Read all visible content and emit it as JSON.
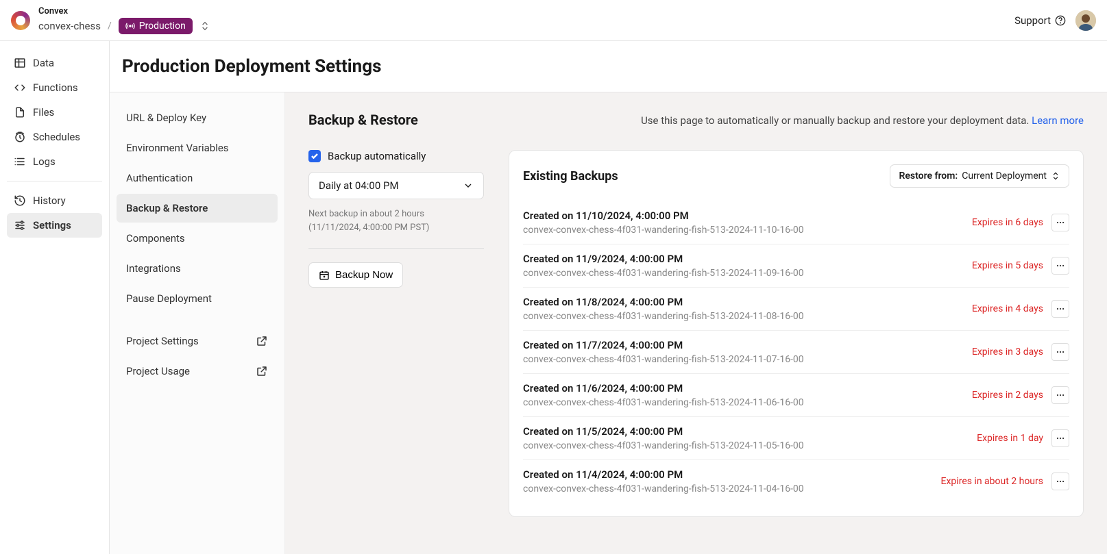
{
  "header": {
    "org": "Convex",
    "project": "convex-chess",
    "env": "Production",
    "support": "Support"
  },
  "leftnav": [
    {
      "icon": "table",
      "label": "Data"
    },
    {
      "icon": "code",
      "label": "Functions"
    },
    {
      "icon": "file",
      "label": "Files"
    },
    {
      "icon": "clock",
      "label": "Schedules"
    },
    {
      "icon": "list",
      "label": "Logs"
    },
    {
      "divider": true
    },
    {
      "icon": "history",
      "label": "History"
    },
    {
      "icon": "sliders",
      "label": "Settings",
      "active": true
    }
  ],
  "page_title": "Production Deployment Settings",
  "settings_nav": [
    {
      "label": "URL & Deploy Key"
    },
    {
      "label": "Environment Variables"
    },
    {
      "label": "Authentication"
    },
    {
      "label": "Backup & Restore",
      "active": true
    },
    {
      "label": "Components"
    },
    {
      "label": "Integrations"
    },
    {
      "label": "Pause Deployment"
    },
    {
      "gap": true
    },
    {
      "label": "Project Settings",
      "external": true
    },
    {
      "label": "Project Usage",
      "external": true
    }
  ],
  "backup": {
    "title": "Backup & Restore",
    "description": "Use this page to automatically or manually backup and restore your deployment data. ",
    "learn_more": "Learn more",
    "auto_label": "Backup automatically",
    "auto_checked": true,
    "schedule": "Daily at 04:00 PM",
    "next_backup_line1": "Next backup in about 2 hours",
    "next_backup_line2": "(11/11/2024, 4:00:00 PM PST)",
    "backup_now": "Backup Now",
    "existing_title": "Existing Backups",
    "restore_label": "Restore from:",
    "restore_value": "Current Deployment",
    "items": [
      {
        "title": "Created on 11/10/2024, 4:00:00 PM",
        "sub": "convex-convex-chess-4f031-wandering-fish-513-2024-11-10-16-00",
        "expires": "Expires in 6 days"
      },
      {
        "title": "Created on 11/9/2024, 4:00:00 PM",
        "sub": "convex-convex-chess-4f031-wandering-fish-513-2024-11-09-16-00",
        "expires": "Expires in 5 days"
      },
      {
        "title": "Created on 11/8/2024, 4:00:00 PM",
        "sub": "convex-convex-chess-4f031-wandering-fish-513-2024-11-08-16-00",
        "expires": "Expires in 4 days"
      },
      {
        "title": "Created on 11/7/2024, 4:00:00 PM",
        "sub": "convex-convex-chess-4f031-wandering-fish-513-2024-11-07-16-00",
        "expires": "Expires in 3 days"
      },
      {
        "title": "Created on 11/6/2024, 4:00:00 PM",
        "sub": "convex-convex-chess-4f031-wandering-fish-513-2024-11-06-16-00",
        "expires": "Expires in 2 days"
      },
      {
        "title": "Created on 11/5/2024, 4:00:00 PM",
        "sub": "convex-convex-chess-4f031-wandering-fish-513-2024-11-05-16-00",
        "expires": "Expires in 1 day"
      },
      {
        "title": "Created on 11/4/2024, 4:00:00 PM",
        "sub": "convex-convex-chess-4f031-wandering-fish-513-2024-11-04-16-00",
        "expires": "Expires in about 2 hours"
      }
    ]
  }
}
